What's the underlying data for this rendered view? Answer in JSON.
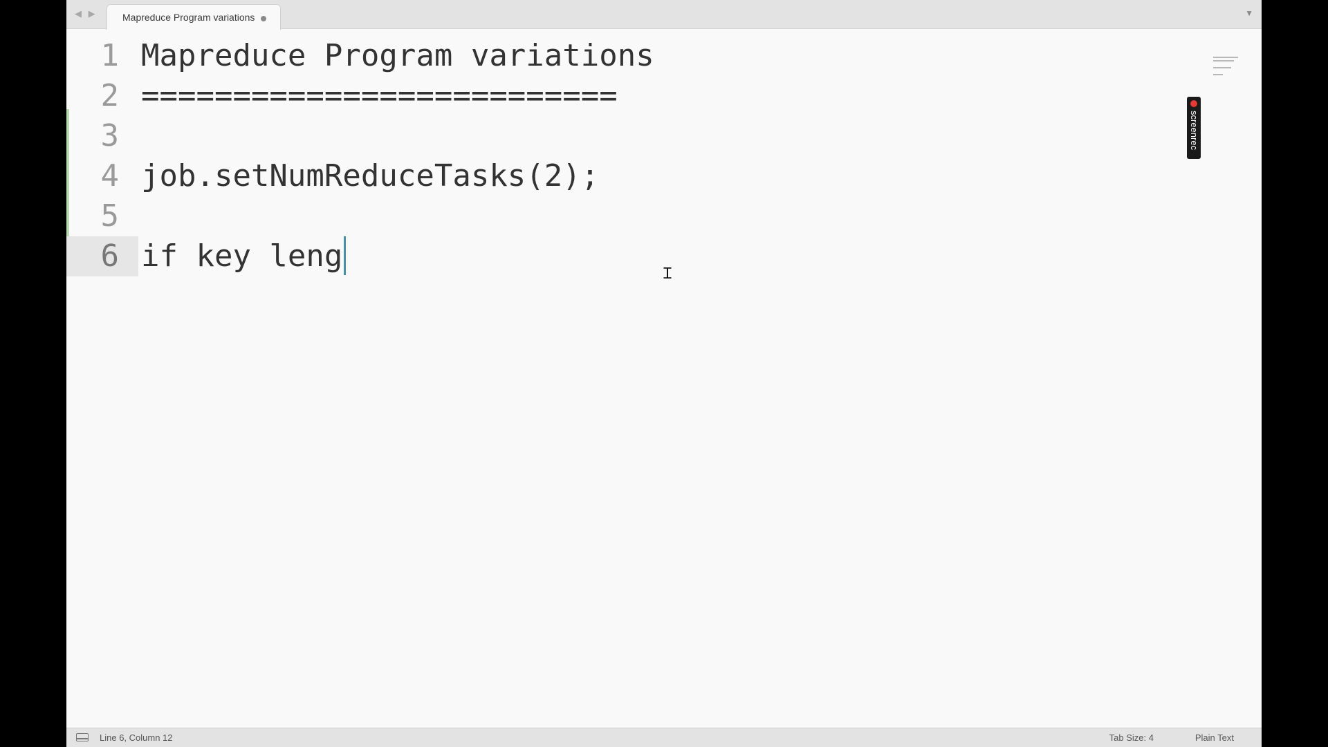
{
  "tab": {
    "title": "Mapreduce Program variations",
    "back_icon": "◀",
    "forward_icon": "▶",
    "dropdown_icon": "▼"
  },
  "editor": {
    "lines": [
      {
        "num": "1",
        "text": "Mapreduce Program variations"
      },
      {
        "num": "2",
        "text": "=========================="
      },
      {
        "num": "3",
        "text": ""
      },
      {
        "num": "4",
        "text": "job.setNumReduceTasks(2);"
      },
      {
        "num": "5",
        "text": ""
      },
      {
        "num": "6",
        "text": "if key leng"
      }
    ],
    "active_line": 6
  },
  "overlay": {
    "screenrec_label": "screenrec"
  },
  "statusbar": {
    "position": "Line 6, Column 12",
    "tab_size": "Tab Size: 4",
    "syntax": "Plain Text"
  },
  "colors": {
    "accent_caret": "#4a8fa8",
    "gutter_modified": "#b9d9b0",
    "rec": "#e53935"
  }
}
